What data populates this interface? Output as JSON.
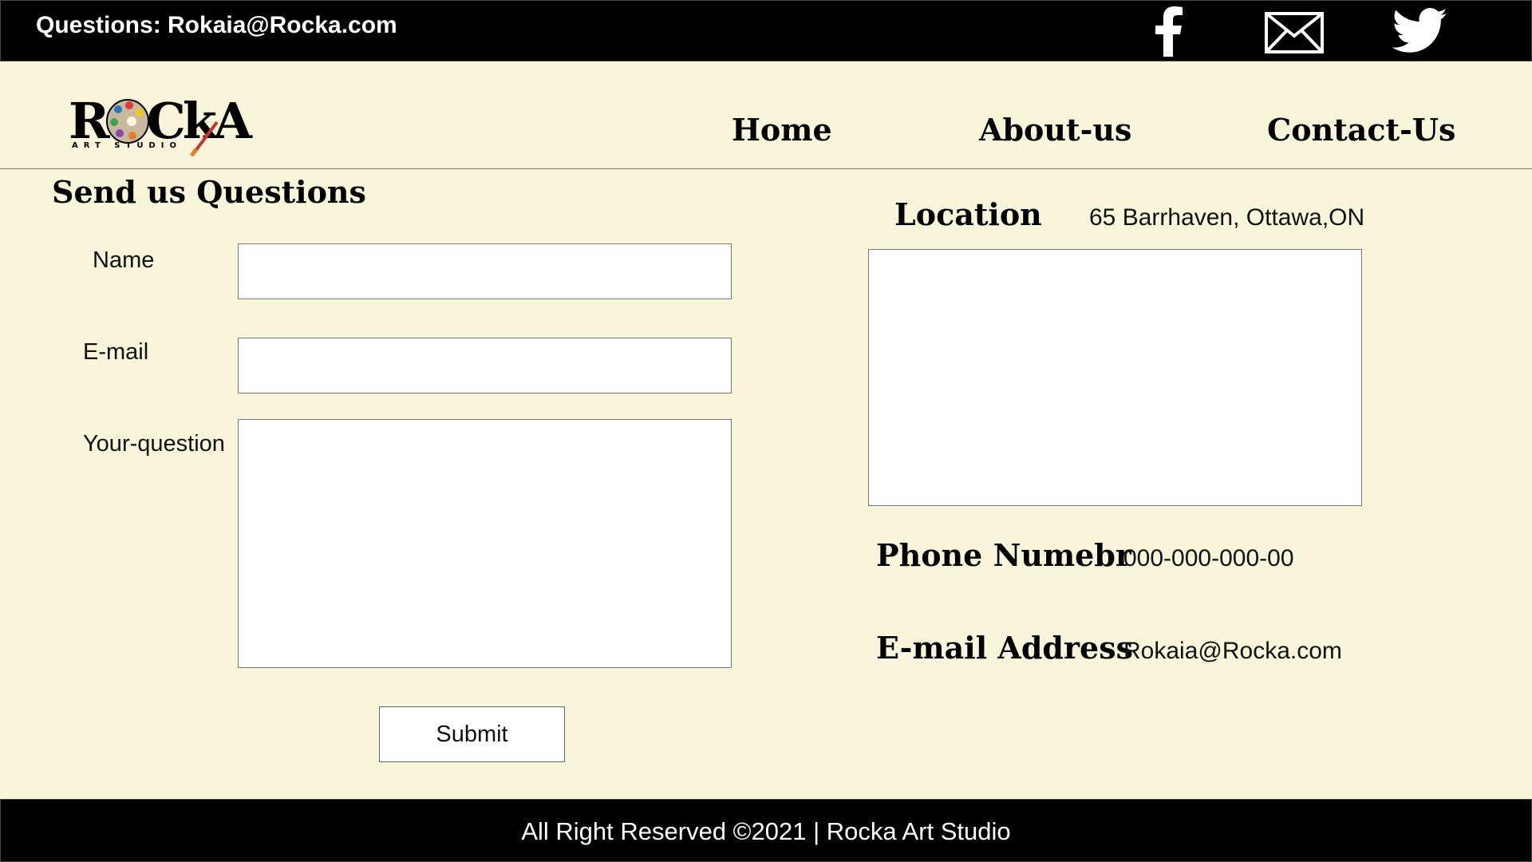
{
  "topbar": {
    "contact_text": "Questions: Rokaia@Rocka.com",
    "social": [
      "facebook-icon",
      "mail-icon",
      "twitter-icon"
    ]
  },
  "logo": {
    "word": "ROCkA",
    "subtitle": "ART STUDIO"
  },
  "nav": {
    "items": [
      {
        "label": "Home"
      },
      {
        "label": "About-us"
      },
      {
        "label": "Contact-Us"
      }
    ]
  },
  "form": {
    "title": "Send us Questions",
    "name_label": "Name",
    "name_value": "",
    "email_label": "E-mail",
    "email_value": "",
    "question_label": "Your-question",
    "question_value": "",
    "submit_label": "Submit"
  },
  "info": {
    "location_label": "Location",
    "location_value": "65 Barrhaven, Ottawa,ON",
    "phone_label": "Phone Numebr",
    "phone_value": "000-000-000-00",
    "email_label": "E-mail Address",
    "email_value": "Rokaia@Rocka.com"
  },
  "footer": {
    "copyright": "All Right Reserved ©2021 | Rocka Art Studio"
  },
  "colors": {
    "background": "#f9f5da",
    "bars": "#000000",
    "bar_text": "#ffffff"
  }
}
